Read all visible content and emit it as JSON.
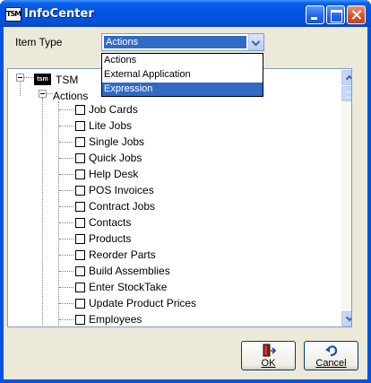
{
  "window": {
    "icon_text": "TSM",
    "title": "InfoCenter"
  },
  "item_type": {
    "label": "Item Type",
    "selected": "Actions",
    "options": [
      "Actions",
      "External Application",
      "Expression"
    ],
    "highlighted_option": "Expression"
  },
  "tree": {
    "root_icon_text": "tsm",
    "root_label": "TSM",
    "group_label": "Actions",
    "items": [
      "Job Cards",
      "Lite Jobs",
      "Single Jobs",
      "Quick Jobs",
      "Help Desk",
      "POS Invoices",
      "Contract Jobs",
      "Contacts",
      "Products",
      "Reorder Parts",
      "Build Assemblies",
      "Enter StockTake",
      "Update Product Prices",
      "Employees"
    ]
  },
  "buttons": {
    "ok": "OK",
    "cancel": "Cancel"
  },
  "colors": {
    "titlebar": "#0054e3",
    "selection": "#316ac5",
    "dialog_background": "#ece9d8"
  }
}
